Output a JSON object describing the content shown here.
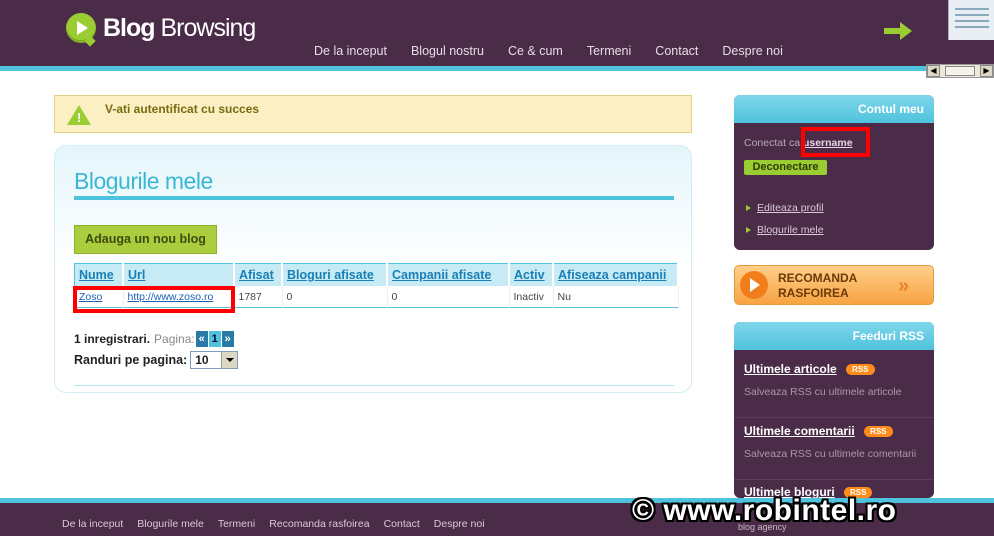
{
  "header": {
    "logo_bold": "Blog",
    "logo_rest": " Browsing",
    "nav": [
      "De la inceput",
      "Blogul nostru",
      "Ce & cum",
      "Termeni",
      "Contact",
      "Despre noi"
    ]
  },
  "alert": {
    "message": "V-ati autentificat cu succes"
  },
  "main": {
    "title": "Blogurile mele",
    "add_button": "Adauga un nou blog",
    "table": {
      "columns": [
        "Nume",
        "Url",
        "Afisat",
        "Bloguri afisate",
        "Campanii afisate",
        "Activ",
        "Afiseaza campanii"
      ],
      "rows": [
        {
          "nume": "Zoso",
          "url": "http://www.zoso.ro",
          "afisat": "1787",
          "bloguri_afisate": "0",
          "campanii_afisate": "0",
          "activ": "Inactiv",
          "afiseaza_campanii": "Nu"
        }
      ]
    },
    "pager": {
      "records": "1 inregistrari.",
      "page_label": "Pagina:",
      "prev": "«",
      "current": "1",
      "next": "»"
    },
    "rows_per_page": {
      "label": "Randuri pe pagina:",
      "value": "10"
    }
  },
  "sidebar": {
    "account": {
      "title": "Contul meu",
      "connected_prefix": "Conectat ca",
      "username": "username",
      "logout": "Deconectare",
      "links": [
        "Editeaza profil",
        "Blogurile mele"
      ]
    },
    "recommend": {
      "line1": "RECOMANDA",
      "line2": "RASFOIREA",
      "arrows": "»"
    },
    "feeds": {
      "title": "Feeduri RSS",
      "badge": "RSS",
      "items": [
        {
          "title": "Ultimele articole",
          "desc": "Salveaza RSS cu ultimele articole"
        },
        {
          "title": "Ultimele comentarii",
          "desc": "Salveaza RSS cu ultimele comentarii"
        },
        {
          "title": "Ultimele bloguri",
          "desc": ""
        }
      ]
    }
  },
  "footer": {
    "nav": [
      "De la inceput",
      "Blogurile mele",
      "Termeni",
      "Recomanda rasfoirea",
      "Contact",
      "Despre noi"
    ],
    "credit": "blog agency"
  },
  "watermark": "© www.robintel.ro",
  "colors": {
    "header_bg": "#4a2c48",
    "accent_cyan": "#4fc3dd",
    "accent_green": "#9acd32",
    "highlight_red": "#ff0000"
  }
}
